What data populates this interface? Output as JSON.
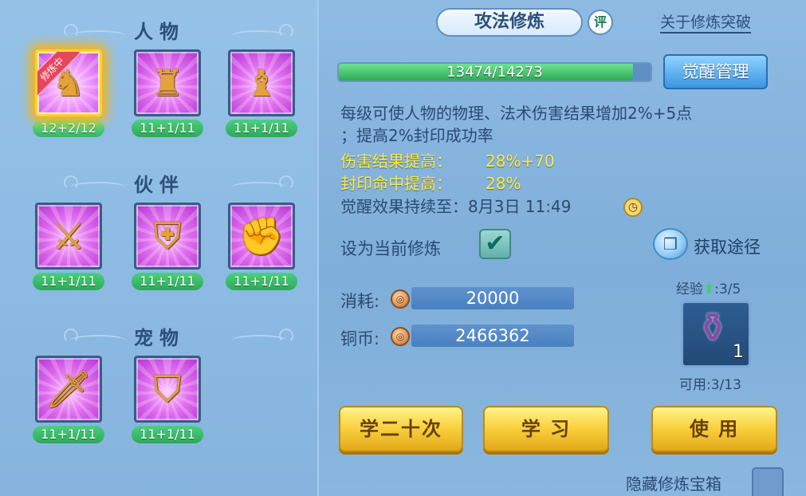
{
  "left": {
    "sections": [
      {
        "title": "人物",
        "slots": [
          {
            "level": "12+2/12",
            "badge": "修炼中",
            "icon": "figure-meditate-icon",
            "active": true
          },
          {
            "level": "11+1/11",
            "icon": "figure-gold-robe-icon"
          },
          {
            "level": "11+1/11",
            "icon": "figure-armored-icon"
          }
        ]
      },
      {
        "title": "伙伴",
        "slots": [
          {
            "level": "11+1/11",
            "icon": "partner-sword-lion-icon"
          },
          {
            "level": "11+1/11",
            "icon": "partner-shield-lion-icon"
          },
          {
            "level": "11+1/11",
            "icon": "partner-fist-lion-icon"
          }
        ]
      },
      {
        "title": "宠物",
        "slots": [
          {
            "level": "11+1/11",
            "icon": "pet-sword-cat-icon"
          },
          {
            "level": "11+1/11",
            "icon": "pet-shield-cat-icon"
          }
        ]
      }
    ]
  },
  "header": {
    "tab_title": "攻法修炼",
    "eval_label": "评",
    "break_link": "关于修炼突破"
  },
  "progress": {
    "text": "13474/14273",
    "current": 13474,
    "max": 14273
  },
  "awaken_button": "觉醒管理",
  "description": {
    "line1": "每级可使人物的物理、法术伤害结果增加2%+5点",
    "line2": "；提高2%封印成功率",
    "damage_label": "伤害结果提高：",
    "damage_value": "28%+70",
    "seal_label": "封印命中提高：",
    "seal_value": "28%",
    "awaken_until": "觉醒效果持续至：8月3日 11:49"
  },
  "set_current": {
    "label": "设为当前修炼",
    "checked": true
  },
  "source": {
    "label": "获取途径"
  },
  "costs": {
    "consume_label": "消耗:",
    "consume_value": "20000",
    "coin_label": "铜币:",
    "coin_value": "2466362"
  },
  "item": {
    "exp_label": "经验",
    "exp_value": ":3/5",
    "count": "1",
    "available": "可用:3/13"
  },
  "buttons": {
    "learn20": "学二十次",
    "learn": "学 习",
    "use": "使 用"
  },
  "hide_chest": {
    "label": "隐藏修炼宝箱",
    "checked": false
  },
  "colors": {
    "accent_blue": "#3a95e2",
    "gold": "#f7cf3a",
    "green": "#2ea85a",
    "highlight_yellow": "#ffea3b"
  }
}
